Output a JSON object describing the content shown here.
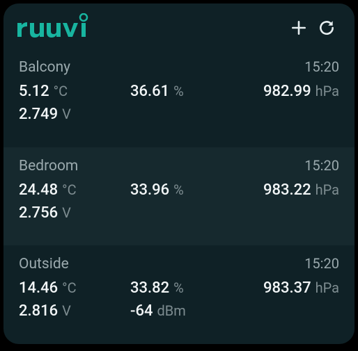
{
  "brand": "ruuvi",
  "sensors": [
    {
      "name": "Balcony",
      "time": "15:20",
      "temperature": "5.12",
      "temperature_unit": "°C",
      "humidity": "36.61",
      "humidity_unit": "%",
      "pressure": "982.99",
      "pressure_unit": "hPa",
      "voltage": "2.749",
      "voltage_unit": "V",
      "signal": "",
      "signal_unit": ""
    },
    {
      "name": "Bedroom",
      "time": "15:20",
      "temperature": "24.48",
      "temperature_unit": "°C",
      "humidity": "33.96",
      "humidity_unit": "%",
      "pressure": "983.22",
      "pressure_unit": "hPa",
      "voltage": "2.756",
      "voltage_unit": "V",
      "signal": "",
      "signal_unit": ""
    },
    {
      "name": "Outside",
      "time": "15:20",
      "temperature": "14.46",
      "temperature_unit": "°C",
      "humidity": "33.82",
      "humidity_unit": "%",
      "pressure": "983.37",
      "pressure_unit": "hPa",
      "voltage": "2.816",
      "voltage_unit": "V",
      "signal": "-64",
      "signal_unit": "dBm"
    }
  ]
}
